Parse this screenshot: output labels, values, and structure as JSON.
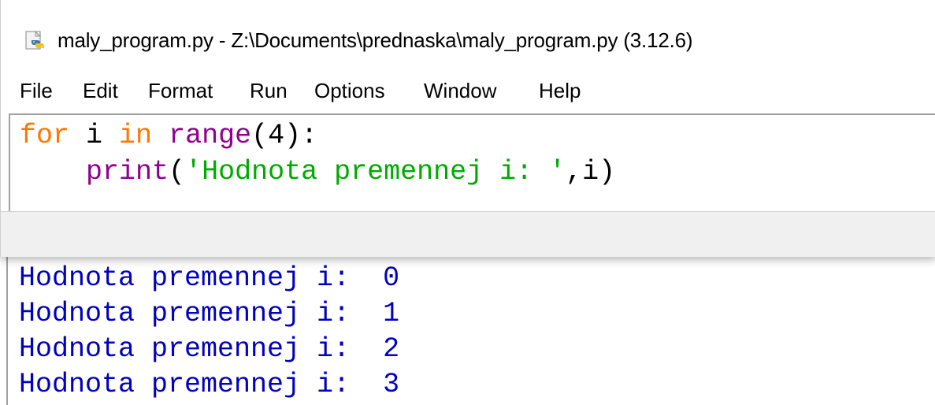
{
  "window": {
    "title": "maly_program.py - Z:\\Documents\\prednaska\\maly_program.py (3.12.6)",
    "icon": "python-file-icon"
  },
  "menu": {
    "items": [
      "File",
      "Edit",
      "Format",
      "Run",
      "Options",
      "Window",
      "Help"
    ]
  },
  "code": {
    "line1": {
      "keyword_for": "for",
      "var": " i ",
      "keyword_in": "in",
      "space": " ",
      "builtin_range": "range",
      "rest": "(4):"
    },
    "line2": {
      "indent": "    ",
      "builtin_print": "print",
      "open": "(",
      "string": "'Hodnota premennej i: '",
      "rest": ",i)"
    }
  },
  "shell": {
    "lines": [
      "Hodnota premennej i:  0",
      "Hodnota premennej i:  1",
      "Hodnota premennej i:  2",
      "Hodnota premennej i:  3"
    ]
  },
  "colors": {
    "keyword": "#ff7700",
    "builtin": "#900090",
    "string": "#00aa00",
    "stdout": "#0000c0"
  }
}
